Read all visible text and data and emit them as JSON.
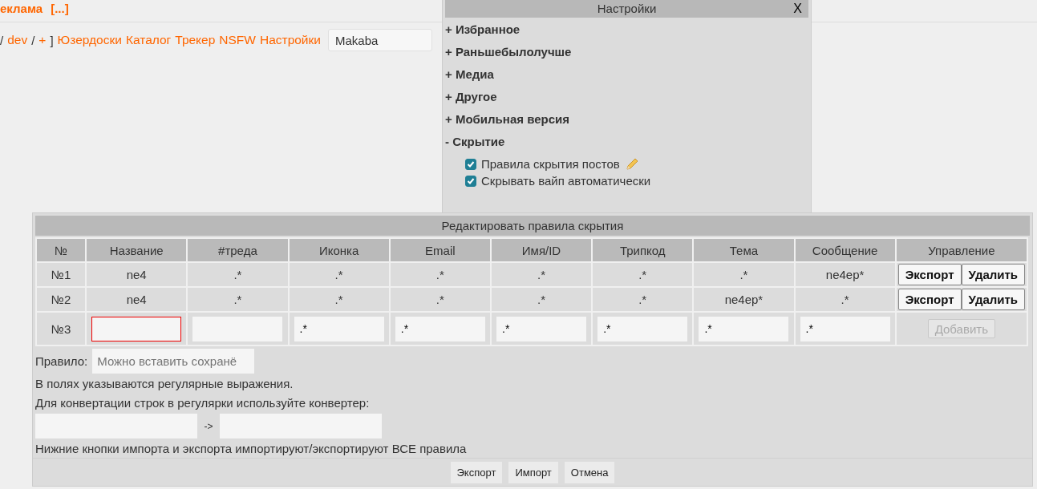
{
  "header_links": [
    {
      "text": "еклама"
    },
    {
      "text": "[...]"
    }
  ],
  "nav": [
    {
      "kind": "text",
      "text": "/"
    },
    {
      "kind": "link",
      "text": "dev"
    },
    {
      "kind": "text",
      "text": "/"
    },
    {
      "kind": "link",
      "text": "+"
    },
    {
      "kind": "text",
      "text": "]"
    },
    {
      "kind": "link",
      "text": "Юзердоски"
    },
    {
      "kind": "link",
      "text": "Каталог"
    },
    {
      "kind": "link",
      "text": "Трекер"
    },
    {
      "kind": "link",
      "text": "NSFW"
    },
    {
      "kind": "link",
      "text": "Настройки"
    }
  ],
  "board_select": {
    "value": "Makaba"
  },
  "settings": {
    "title": "Настройки",
    "close": "X",
    "sections": [
      {
        "toggle": "+",
        "label": "Избранное"
      },
      {
        "toggle": "+",
        "label": "Раньшебылолучше"
      },
      {
        "toggle": "+",
        "label": "Медиа"
      },
      {
        "toggle": "+",
        "label": "Другое"
      },
      {
        "toggle": "+",
        "label": "Мобильная версия"
      },
      {
        "toggle": "-",
        "label": "Скрытие",
        "options": [
          {
            "kind": "editable",
            "label": "Правила скрытия постов",
            "checked": true
          },
          {
            "kind": "plain",
            "label": "Скрывать вайп автоматически",
            "checked": true
          }
        ]
      }
    ]
  },
  "rules": {
    "title": "Редактировать правила скрытия",
    "columns": [
      "№",
      "Название",
      "#треда",
      "Иконка",
      "Email",
      "Имя/ID",
      "Трипкод",
      "Тема",
      "Сообщение",
      "Управление"
    ],
    "rows": [
      {
        "cells": [
          "№1",
          "ne4",
          ".*",
          ".*",
          ".*",
          ".*",
          ".*",
          ".*",
          "ne4ep*"
        ],
        "actions": [
          "Экспорт",
          "Удалить"
        ]
      },
      {
        "cells": [
          "№2",
          "ne4",
          ".*",
          ".*",
          ".*",
          ".*",
          ".*",
          "ne4ep*",
          ".*"
        ],
        "actions": [
          "Экспорт",
          "Удалить"
        ]
      }
    ],
    "new_row": {
      "number": "№3",
      "fields": [
        {
          "error": true
        },
        {
          "error": false
        },
        {
          "value": ".*",
          "error": false
        },
        {
          "value": ".*",
          "error": false
        },
        {
          "value": ".*",
          "error": false
        },
        {
          "value": ".*",
          "error": false
        },
        {
          "value": ".*",
          "error": false
        },
        {
          "value": ".*",
          "error": false
        }
      ],
      "add_button": {
        "label": "Добавить",
        "disabled": true
      }
    },
    "rule_field": {
      "label": "Правило:",
      "placeholder": "Можно вставить сохранё"
    },
    "notes": [
      "В полях указываются регулярные выражения.",
      "Для конвертации строк в регулярки используйте конвертер:"
    ],
    "converter": {
      "arrow": "->"
    },
    "footer_note": "Нижние кнопки импорта и экспорта импортируют/экспортируют ВСЕ правила",
    "buttons": [
      "Экспорт",
      "Импорт",
      "Отмена"
    ]
  }
}
